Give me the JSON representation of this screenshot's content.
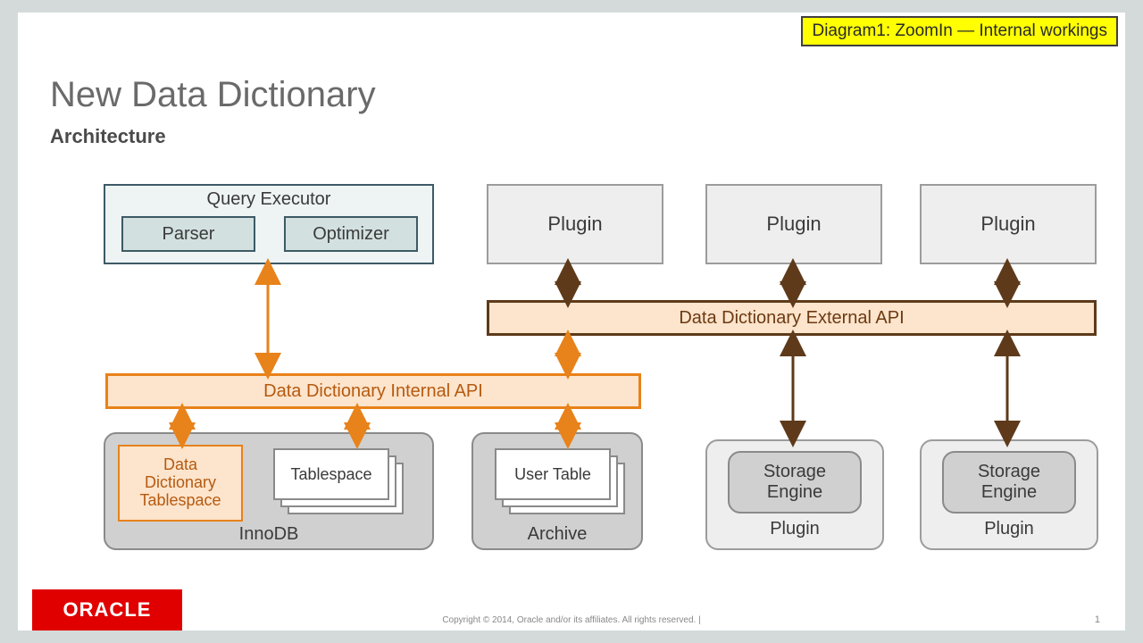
{
  "callout": "Diagram1:  ZoomIn — Internal workings",
  "title": "New Data Dictionary",
  "subtitle": "Architecture",
  "qe": {
    "title": "Query Executor",
    "parser": "Parser",
    "optimizer": "Optimizer"
  },
  "plugins_top": [
    "Plugin",
    "Plugin",
    "Plugin"
  ],
  "ext_api": "Data Dictionary External API",
  "int_api": "Data Dictionary Internal API",
  "innodb": {
    "label": "InnoDB",
    "ddtbs": "Data\nDictionary\nTablespace",
    "tablespace": "Tablespace"
  },
  "archive": {
    "label": "Archive",
    "usertable": "User Table"
  },
  "storage_plugin": {
    "inner": "Storage\nEngine",
    "label": "Plugin"
  },
  "brand": "ORACLE",
  "copyright": "Copyright © 2014, Oracle and/or its affiliates. All rights reserved.  |",
  "page": "1",
  "arrows": {
    "orange": "#e8821a",
    "brown": "#5e3a1a"
  }
}
